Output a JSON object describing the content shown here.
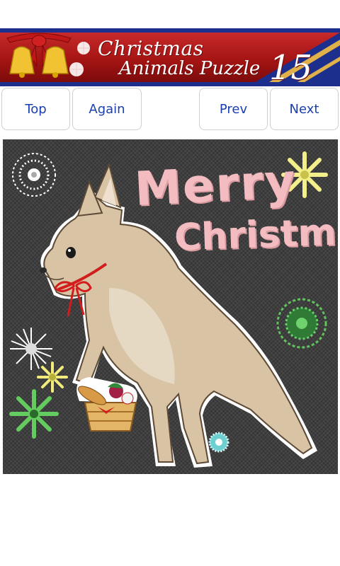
{
  "banner": {
    "title_line1": "Christmas",
    "title_line2": "Animals Puzzle",
    "number": "15",
    "colors": {
      "frame": "#1d2f8c",
      "red": "#b81c1c",
      "gold": "#d9a93a"
    }
  },
  "nav": {
    "top_label": "Top",
    "again_label": "Again",
    "prev_label": "Prev",
    "next_label": "Next",
    "label_color": "#1a3fb0"
  },
  "puzzle": {
    "text_line1": "Merry",
    "text_line2": "Christmas!",
    "background": "#3f3f3f",
    "text_color": "#f2bcc0",
    "subject": "kangaroo-with-basket"
  }
}
